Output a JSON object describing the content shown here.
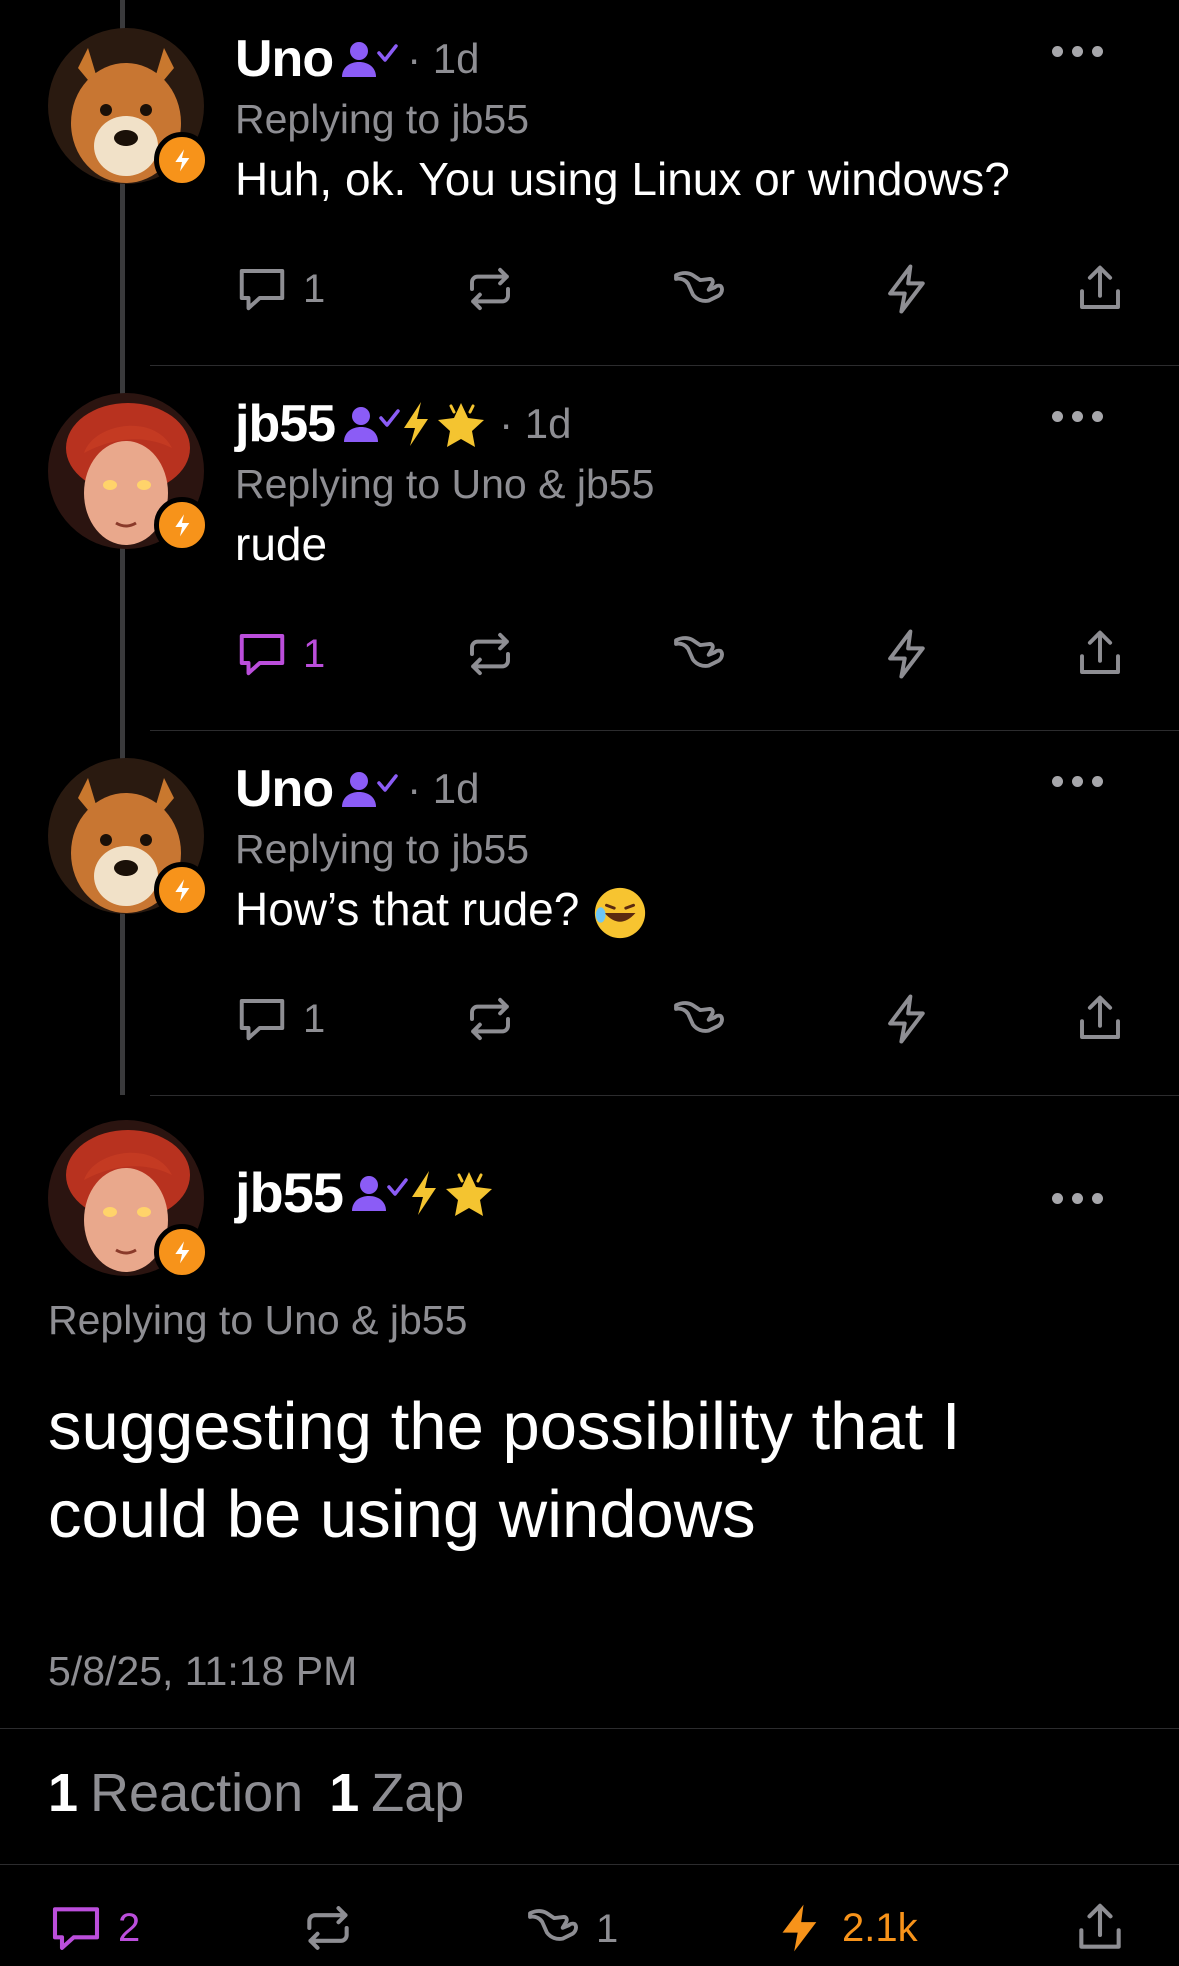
{
  "posts": [
    {
      "name": "Uno",
      "time": "· 1d",
      "reply_to": "Replying to jb55",
      "content": "Huh, ok. You using Linux or windows?",
      "replies": "1",
      "zap": "",
      "reply_active": false
    },
    {
      "name": "jb55",
      "time": "· 1d",
      "reply_to": "Replying to Uno & jb55",
      "content": "rude",
      "replies": "1",
      "zap": "",
      "reply_active": true
    },
    {
      "name": "Uno",
      "time": "· 1d",
      "reply_to": "Replying to jb55",
      "content": "How’s that rude?",
      "replies": "1",
      "zap": "",
      "reply_active": false
    }
  ],
  "main": {
    "name": "jb55",
    "reply_to": "Replying to Uno & jb55",
    "content": "suggesting the possibility that I could be using windows",
    "timestamp": "5/8/25, 11:18 PM",
    "reactions_count": "1",
    "reactions_label": "Reaction",
    "zaps_count": "1",
    "zaps_label": "Zap",
    "reply_count": "2",
    "like_count": "1",
    "zap_amount": "2.1k"
  },
  "colors": {
    "accent_purple": "#bb4edb",
    "zap_orange": "#f7931a",
    "verified_purple": "#8b5cf6",
    "muted": "#8e8e93",
    "background": "#000000"
  },
  "icons": [
    "reply-icon",
    "repost-icon",
    "shaka-icon",
    "zap-icon",
    "share-icon",
    "more-icon",
    "verified-icon",
    "bolt-badge-icon",
    "star-badge-icon"
  ]
}
